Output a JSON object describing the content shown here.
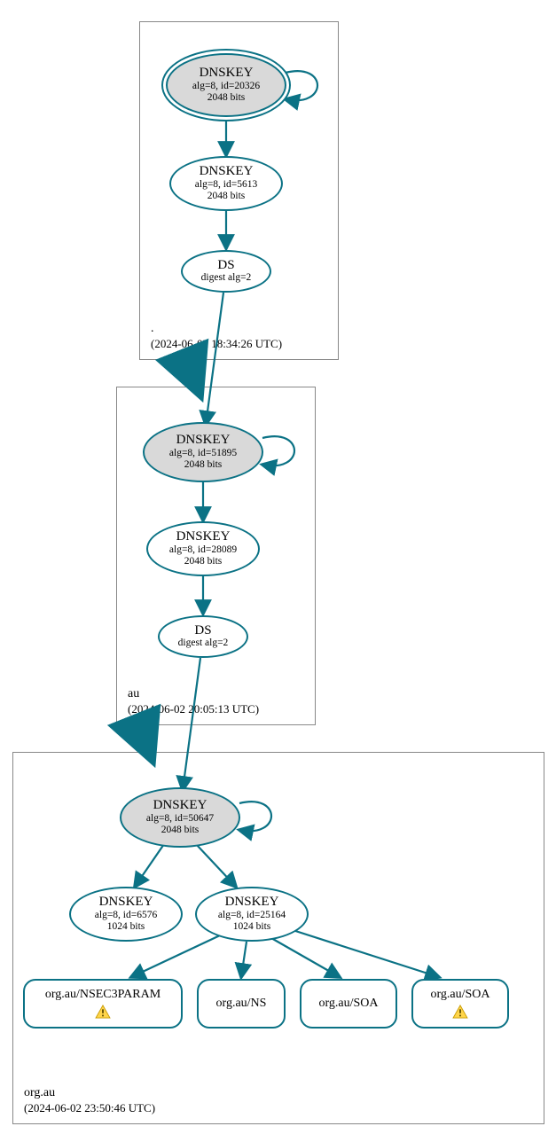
{
  "colors": {
    "edge": "#0b7285",
    "box": "#888888",
    "ksk_fill": "#d9d9d9"
  },
  "zones": {
    "root": {
      "name": ".",
      "time": "(2024-06-02 18:34:26 UTC)"
    },
    "au": {
      "name": "au",
      "time": "(2024-06-02 20:05:13 UTC)"
    },
    "orgau": {
      "name": "org.au",
      "time": "(2024-06-02 23:50:46 UTC)"
    }
  },
  "nodes": {
    "root_ksk": {
      "title": "DNSKEY",
      "alg": "alg=8, id=20326",
      "bits": "2048 bits"
    },
    "root_zsk": {
      "title": "DNSKEY",
      "alg": "alg=8, id=5613",
      "bits": "2048 bits"
    },
    "root_ds": {
      "title": "DS",
      "alg": "digest alg=2"
    },
    "au_ksk": {
      "title": "DNSKEY",
      "alg": "alg=8, id=51895",
      "bits": "2048 bits"
    },
    "au_zsk": {
      "title": "DNSKEY",
      "alg": "alg=8, id=28089",
      "bits": "2048 bits"
    },
    "au_ds": {
      "title": "DS",
      "alg": "digest alg=2"
    },
    "org_ksk": {
      "title": "DNSKEY",
      "alg": "alg=8, id=50647",
      "bits": "2048 bits"
    },
    "org_zsk1": {
      "title": "DNSKEY",
      "alg": "alg=8, id=6576",
      "bits": "1024 bits"
    },
    "org_zsk2": {
      "title": "DNSKEY",
      "alg": "alg=8, id=25164",
      "bits": "1024 bits"
    },
    "rr_nsec3": {
      "label": "org.au/NSEC3PARAM"
    },
    "rr_ns": {
      "label": "org.au/NS"
    },
    "rr_soa1": {
      "label": "org.au/SOA"
    },
    "rr_soa2": {
      "label": "org.au/SOA"
    }
  }
}
